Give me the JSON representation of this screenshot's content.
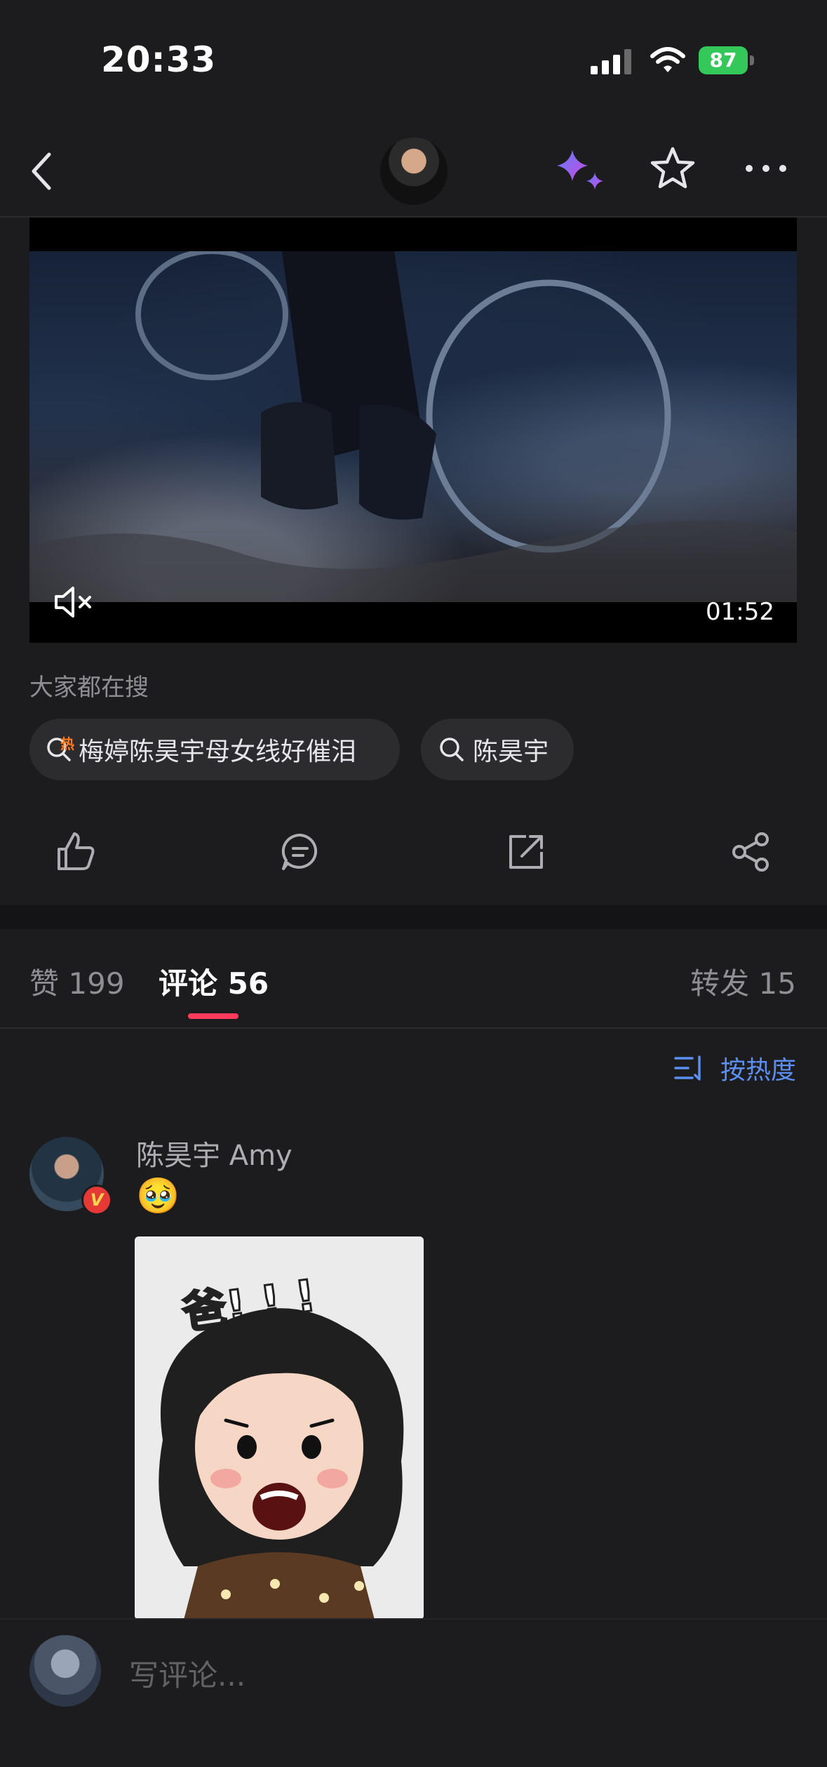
{
  "status_bar": {
    "time": "20:33",
    "battery": "87"
  },
  "nav": {
    "back_icon": "chevron-left-icon",
    "ai_icon": "sparkles-icon",
    "favorite_icon": "star-icon",
    "more_icon": "more-horizontal-icon"
  },
  "video": {
    "duration": "01:52",
    "mute_icon": "speaker-muted-icon"
  },
  "hot_search": {
    "label": "大家都在搜",
    "hot_badge": "热",
    "chips": [
      {
        "text": "梅婷陈昊宇母女线好催泪"
      },
      {
        "text": "陈昊宇"
      }
    ]
  },
  "actions": [
    "thumbs-up-icon",
    "comment-icon",
    "repost-icon",
    "share-icon"
  ],
  "tabs": {
    "likes": {
      "label": "赞",
      "count": "199"
    },
    "comments": {
      "label": "评论",
      "count": "56"
    },
    "reposts": {
      "label": "转发",
      "count": "15"
    }
  },
  "sort": {
    "label": "按热度"
  },
  "comment": {
    "author": "陈昊宇 Amy",
    "emoji": "🥹",
    "verified": "V",
    "sticker_text": "爸! ! !"
  },
  "bottom_bar": {
    "placeholder": "写评论..."
  },
  "colors": {
    "accent": "#ff3b5c",
    "link": "#5b8ff0",
    "background": "#1c1c1e",
    "battery": "#34c759"
  }
}
